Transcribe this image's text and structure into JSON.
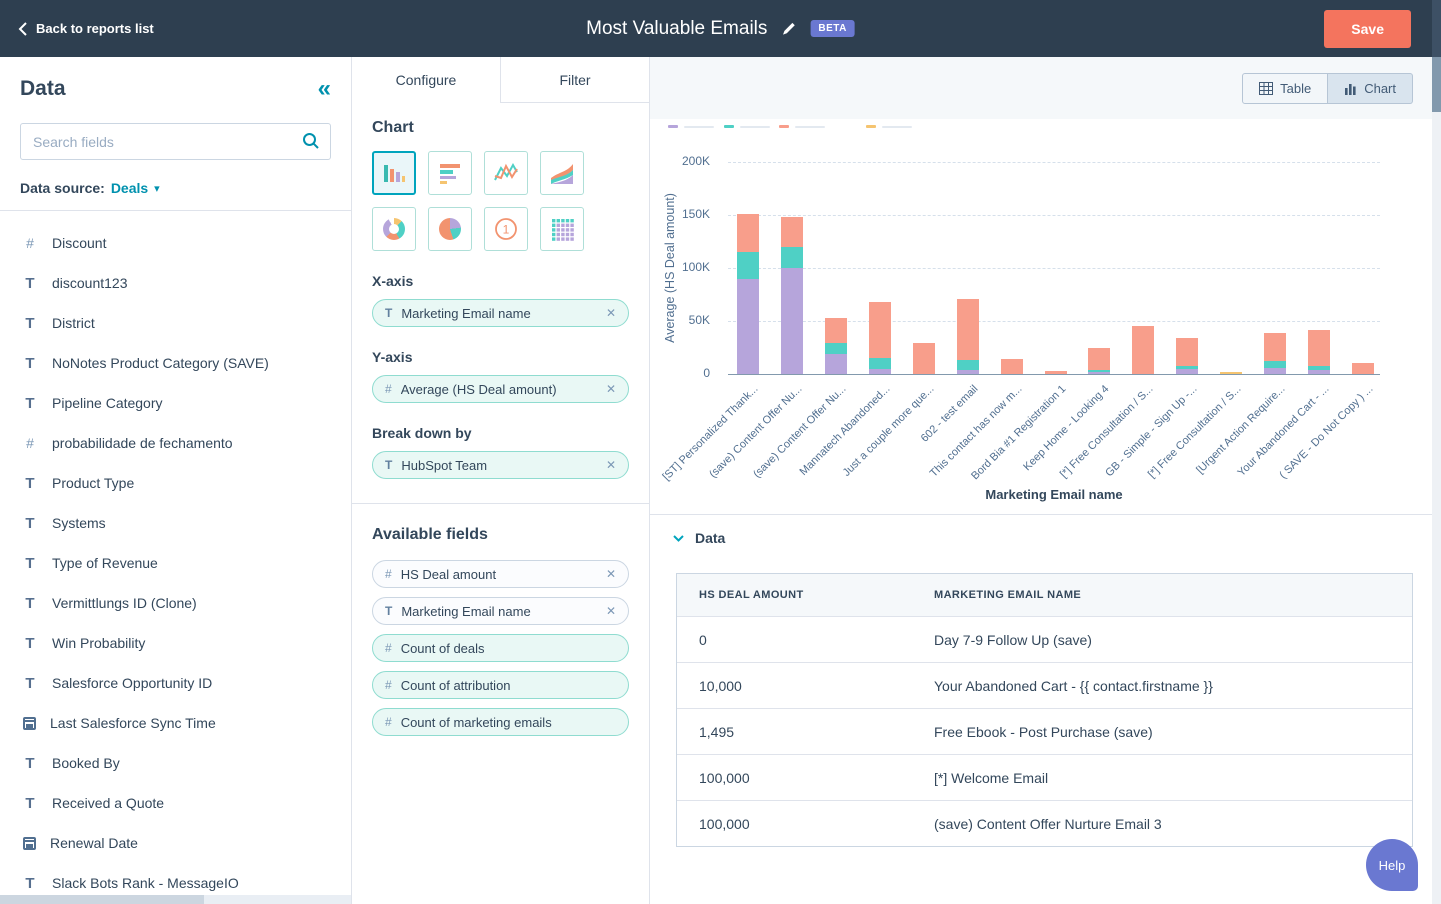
{
  "topbar": {
    "back_label": "Back to reports list",
    "title": "Most Valuable Emails",
    "beta_label": "BETA",
    "save_label": "Save"
  },
  "sidebar": {
    "title": "Data",
    "search_placeholder": "Search fields",
    "data_source_label": "Data source:",
    "data_source_value": "Deals",
    "fields": [
      {
        "type": "number",
        "label": "Discount"
      },
      {
        "type": "text",
        "label": "discount123"
      },
      {
        "type": "text",
        "label": "District"
      },
      {
        "type": "text",
        "label": "NoNotes Product Category (SAVE)"
      },
      {
        "type": "text",
        "label": "Pipeline Category"
      },
      {
        "type": "number",
        "label": "probabilidade de fechamento"
      },
      {
        "type": "text",
        "label": "Product Type"
      },
      {
        "type": "text",
        "label": "Systems"
      },
      {
        "type": "text",
        "label": "Type of Revenue"
      },
      {
        "type": "text",
        "label": "Vermittlungs ID (Clone)"
      },
      {
        "type": "text",
        "label": "Win Probability"
      },
      {
        "type": "text",
        "label": "Salesforce Opportunity ID"
      },
      {
        "type": "date",
        "label": "Last Salesforce Sync Time"
      },
      {
        "type": "text",
        "label": "Booked By"
      },
      {
        "type": "text",
        "label": "Received a Quote"
      },
      {
        "type": "date",
        "label": "Renewal Date"
      },
      {
        "type": "text",
        "label": "Slack Bots Rank - MessageIO"
      }
    ]
  },
  "config": {
    "tabs": [
      {
        "label": "Configure",
        "active": true
      },
      {
        "label": "Filter",
        "active": false
      }
    ],
    "chart_section_label": "Chart",
    "selected_chart_type": "column",
    "x_axis_label": "X-axis",
    "x_axis_pill": {
      "type": "text",
      "label": "Marketing Email name",
      "removable": true
    },
    "y_axis_label": "Y-axis",
    "y_axis_pill": {
      "type": "number",
      "label": "Average (HS Deal amount)",
      "removable": true
    },
    "breakdown_label": "Break down by",
    "breakdown_pill": {
      "type": "text",
      "label": "HubSpot Team",
      "removable": true
    },
    "available_fields_label": "Available fields",
    "available_fields": [
      {
        "type": "number",
        "label": "HS Deal amount",
        "removable": true,
        "variant": "gray"
      },
      {
        "type": "text",
        "label": "Marketing Email name",
        "removable": true,
        "variant": "gray"
      },
      {
        "type": "number",
        "label": "Count of deals",
        "removable": false,
        "variant": "mint"
      },
      {
        "type": "number",
        "label": "Count of attribution",
        "removable": false,
        "variant": "mint"
      },
      {
        "type": "number",
        "label": "Count of marketing emails",
        "removable": false,
        "variant": "mint"
      }
    ]
  },
  "view_toggle": {
    "table_label": "Table",
    "chart_label": "Chart",
    "selected": "Chart"
  },
  "chart_data": {
    "type": "bar",
    "stacked": true,
    "xlabel": "Marketing Email name",
    "ylabel": "Average (HS Deal amount)",
    "ylim": [
      0,
      200000
    ],
    "ytick_labels": [
      "200K",
      "150K",
      "100K",
      "50K",
      "0"
    ],
    "grid": true,
    "legend_position": "top-clipped",
    "categories": [
      "[ST] Personalized Thank...",
      "(save) Content Offer Nu...",
      "(save) Content Offer Nu...",
      "Mannatech Abandoned...",
      "Just a couple more que...",
      "602 - test email",
      "This contact has now m...",
      "Bord Bia #1 Registration 1",
      "Keep Home - Looking 4",
      "[*] Free Consultation / S...",
      "GB - Simple - Sign Up -...",
      "[*] Free Consultation / S...",
      "[Urgent Action Require...",
      "Your Abandoned Cart - ...",
      "( SAVE - Do Not Copy ) ..."
    ],
    "series": [
      {
        "name": "purple",
        "color": "#b6a5db",
        "values": [
          90000,
          100000,
          19000,
          5000,
          0,
          4000,
          0,
          0,
          2000,
          0,
          5000,
          0,
          6000,
          4000,
          0
        ]
      },
      {
        "name": "teal",
        "color": "#4fd0c5",
        "values": [
          25000,
          20000,
          10000,
          10000,
          0,
          9000,
          0,
          0,
          2000,
          0,
          3000,
          0,
          6000,
          4000,
          0
        ]
      },
      {
        "name": "salmon",
        "color": "#f89e8b",
        "values": [
          36000,
          28000,
          24000,
          53000,
          29000,
          58000,
          14000,
          3000,
          21000,
          45000,
          26000,
          0,
          27000,
          34000,
          10000
        ]
      },
      {
        "name": "yellow",
        "color": "#f5c470",
        "values": [
          0,
          0,
          0,
          0,
          0,
          0,
          0,
          0,
          0,
          0,
          0,
          2000,
          0,
          0,
          0
        ]
      }
    ]
  },
  "data_section": {
    "title": "Data",
    "table": {
      "headers": [
        "HS DEAL AMOUNT",
        "MARKETING EMAIL NAME"
      ],
      "rows": [
        [
          "0",
          "Day 7-9 Follow Up (save)"
        ],
        [
          "10,000",
          "Your Abandoned Cart - {{ contact.firstname }}"
        ],
        [
          "1,495",
          "Free Ebook - Post Purchase (save)"
        ],
        [
          "100,000",
          "[*] Welcome Email"
        ],
        [
          "100,000",
          "(save) Content Offer Nurture Email 3"
        ]
      ]
    }
  },
  "help_label": "Help",
  "colors": {
    "topbar_bg": "#2e3f50",
    "save_button": "#f4745e",
    "beta_badge": "#6a78d1",
    "accent_teal": "#0091ae",
    "series_purple": "#b6a5db",
    "series_teal": "#4fd0c5",
    "series_salmon": "#f89e8b",
    "series_yellow": "#f5c470"
  }
}
